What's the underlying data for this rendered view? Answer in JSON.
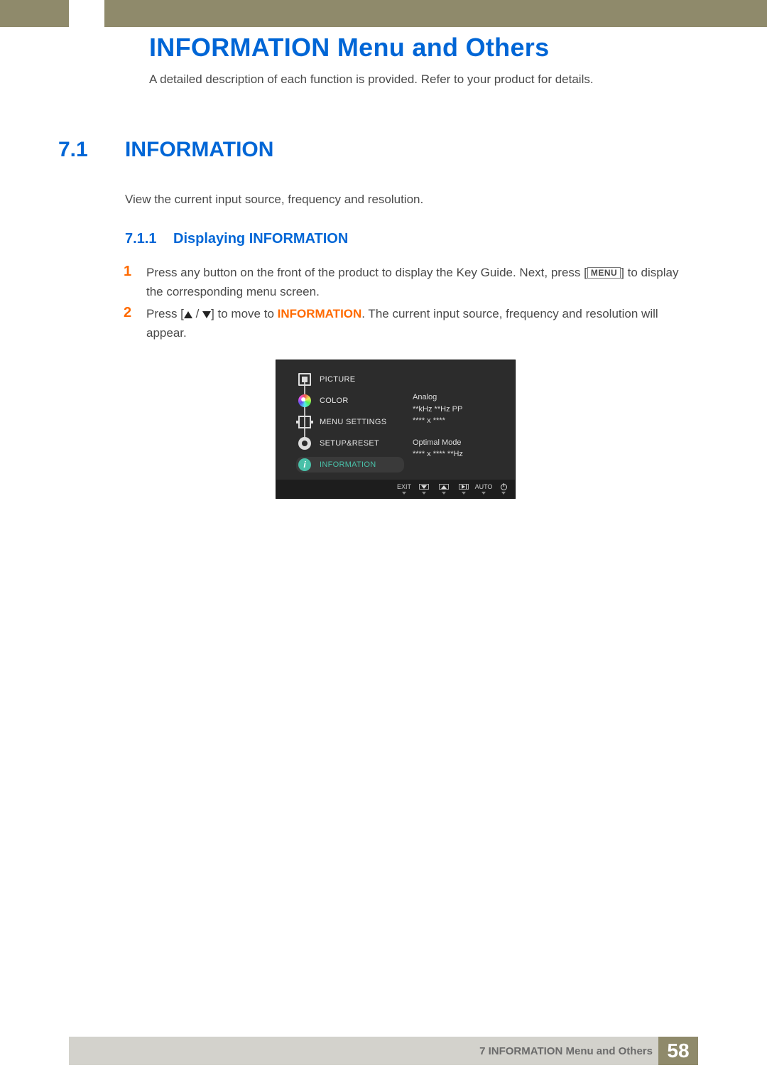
{
  "header": {
    "chapter_title": "INFORMATION Menu and Others",
    "chapter_desc": "A detailed description of each function is provided. Refer to your product for details."
  },
  "section": {
    "num": "7.1",
    "title": "INFORMATION",
    "desc": "View the current input source, frequency and resolution."
  },
  "subsection": {
    "num": "7.1.1",
    "title": "Displaying INFORMATION"
  },
  "steps": {
    "s1_num": "1",
    "s1_a": "Press any button on the front of the product to display the Key Guide. Next, press [",
    "s1_menu": "MENU",
    "s1_b": "] to display the corresponding menu screen.",
    "s2_num": "2",
    "s2_a": "Press [",
    "s2_slash": " / ",
    "s2_b": "] to move to ",
    "s2_info": "INFORMATION",
    "s2_c": ". The current input source, frequency and resolution will appear."
  },
  "osd": {
    "menu": {
      "picture": "PICTURE",
      "color": "COLOR",
      "menu_settings": "MENU SETTINGS",
      "setup_reset": "SETUP&RESET",
      "information": "INFORMATION"
    },
    "info": {
      "l1": "Analog",
      "l2": "**kHz  **Hz  PP",
      "l3": "**** x ****",
      "m1": "Optimal Mode",
      "m2": "**** x ****    **Hz"
    },
    "btns": {
      "exit": "EXIT",
      "auto": "AUTO"
    }
  },
  "footer": {
    "text": "7 INFORMATION Menu and Others",
    "page": "58"
  }
}
